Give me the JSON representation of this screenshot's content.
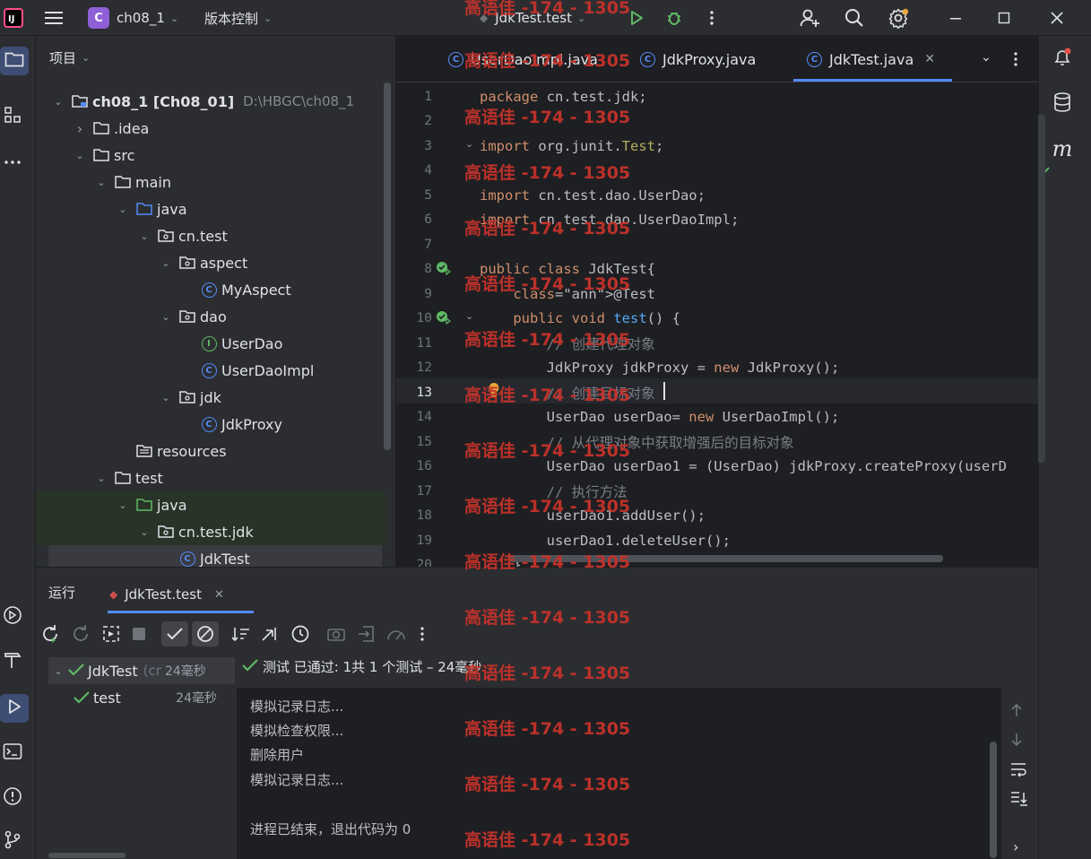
{
  "titlebar": {
    "project_badge": "C",
    "project_name": "ch08_1",
    "vcs_label": "版本控制",
    "run_config": "JdkTest.test"
  },
  "project_panel": {
    "title": "项目",
    "tree": [
      {
        "label": "ch08_1 [Ch08_01]",
        "path": "D:\\HBGC\\ch08_1",
        "icon": "module-folder-icon",
        "depth": 0,
        "expanded": true
      },
      {
        "label": ".idea",
        "icon": "folder-icon",
        "depth": 1,
        "expanded": false
      },
      {
        "label": "src",
        "icon": "folder-icon",
        "depth": 1,
        "expanded": true
      },
      {
        "label": "main",
        "icon": "folder-icon",
        "depth": 2,
        "expanded": true
      },
      {
        "label": "java",
        "icon": "source-folder-icon",
        "depth": 3,
        "expanded": true
      },
      {
        "label": "cn.test",
        "icon": "package-icon",
        "depth": 4,
        "expanded": true
      },
      {
        "label": "aspect",
        "icon": "package-icon",
        "depth": 5,
        "expanded": true
      },
      {
        "label": "MyAspect",
        "icon": "class-icon",
        "depth": 6
      },
      {
        "label": "dao",
        "icon": "package-icon",
        "depth": 5,
        "expanded": true
      },
      {
        "label": "UserDao",
        "icon": "interface-icon",
        "depth": 6
      },
      {
        "label": "UserDaoImpl",
        "icon": "class-icon",
        "depth": 6
      },
      {
        "label": "jdk",
        "icon": "package-icon",
        "depth": 5,
        "expanded": true
      },
      {
        "label": "JdkProxy",
        "icon": "class-icon",
        "depth": 6
      },
      {
        "label": "resources",
        "icon": "resources-folder-icon",
        "depth": 3
      },
      {
        "label": "test",
        "icon": "folder-icon",
        "depth": 2,
        "expanded": true
      },
      {
        "label": "java",
        "icon": "test-folder-icon",
        "depth": 3,
        "expanded": true
      },
      {
        "label": "cn.test.jdk",
        "icon": "package-icon",
        "depth": 4,
        "expanded": true
      },
      {
        "label": "JdkTest",
        "icon": "class-icon",
        "depth": 5,
        "selected": true
      }
    ]
  },
  "editor": {
    "tabs": [
      {
        "label": "UserDaoImpl.java",
        "active": false
      },
      {
        "label": "JdkProxy.java",
        "active": false
      },
      {
        "label": "JdkTest.java",
        "active": true
      }
    ],
    "lines": [
      {
        "n": "1",
        "text": "package cn.test.jdk;"
      },
      {
        "n": "2",
        "text": ""
      },
      {
        "n": "3",
        "text": "import org.junit.Test;"
      },
      {
        "n": "4",
        "text": ""
      },
      {
        "n": "5",
        "text": "import cn.test.dao.UserDao;"
      },
      {
        "n": "6",
        "text": "import cn.test.dao.UserDaoImpl;"
      },
      {
        "n": "7",
        "text": ""
      },
      {
        "n": "8",
        "text": "public class JdkTest{"
      },
      {
        "n": "9",
        "text": "    @Test"
      },
      {
        "n": "10",
        "text": "    public void test() {"
      },
      {
        "n": "11",
        "text": "        // 创建代理对象"
      },
      {
        "n": "12",
        "text": "        JdkProxy jdkProxy = new JdkProxy();"
      },
      {
        "n": "13",
        "text": "        // 创建目标对象"
      },
      {
        "n": "14",
        "text": "        UserDao userDao= new UserDaoImpl();"
      },
      {
        "n": "15",
        "text": "        // 从代理对象中获取增强后的目标对象"
      },
      {
        "n": "16",
        "text": "        UserDao userDao1 = (UserDao) jdkProxy.createProxy(userD"
      },
      {
        "n": "17",
        "text": "        // 执行方法"
      },
      {
        "n": "18",
        "text": "        userDao1.addUser();"
      },
      {
        "n": "19",
        "text": "        userDao1.deleteUser();"
      },
      {
        "n": "20",
        "text": "    }"
      }
    ]
  },
  "run_panel": {
    "title": "运行",
    "tab_label": "JdkTest.test",
    "status": "测试 已通过: 1共 1 个测试 – 24毫秒",
    "tree": [
      {
        "label": "JdkTest",
        "sub": "(cr",
        "time": "24毫秒"
      },
      {
        "label": "test",
        "time": "24毫秒"
      }
    ],
    "console": [
      "模拟记录日志...",
      "模拟检查权限...",
      "删除用户",
      "模拟记录日志...",
      "",
      "进程已结束，退出代码为 0"
    ]
  },
  "watermark": "高语佳 -174 - 1305",
  "colors": {
    "accent": "#548af7",
    "pass": "#5fb865",
    "keyword": "#cf8e6d",
    "watermark": "#c4322b"
  }
}
